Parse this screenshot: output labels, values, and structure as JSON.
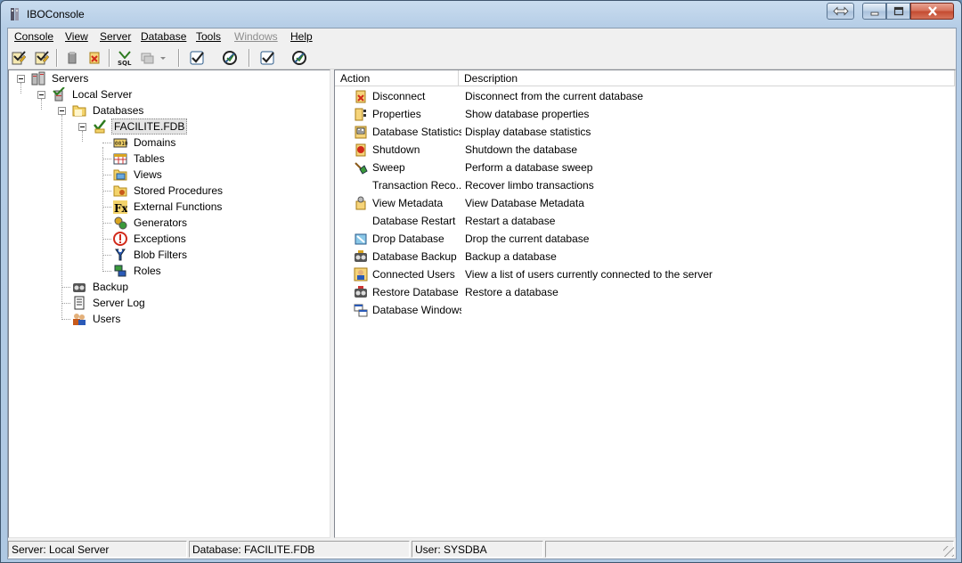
{
  "window": {
    "title": "IBOConsole"
  },
  "menu": [
    "Console",
    "View",
    "Server",
    "Database",
    "Tools",
    "Windows",
    "Help"
  ],
  "tree": {
    "servers": "Servers",
    "local_server": "Local Server",
    "databases": "Databases",
    "database": "FACILITE.FDB",
    "db_children": [
      "Domains",
      "Tables",
      "Views",
      "Stored Procedures",
      "External Functions",
      "Generators",
      "Exceptions",
      "Blob Filters",
      "Roles"
    ],
    "backup": "Backup",
    "server_log": "Server Log",
    "users": "Users"
  },
  "list": {
    "columns": [
      "Action",
      "Description"
    ],
    "rows": [
      {
        "action": "Disconnect",
        "description": "Disconnect from the current database",
        "icon": "disconnect-icon"
      },
      {
        "action": "Properties",
        "description": "Show database properties",
        "icon": "properties-icon"
      },
      {
        "action": "Database Statistics",
        "description": "Display database statistics",
        "icon": "statistics-icon"
      },
      {
        "action": "Shutdown",
        "description": "Shutdown the database",
        "icon": "shutdown-icon"
      },
      {
        "action": "Sweep",
        "description": "Perform a database sweep",
        "icon": "sweep-icon"
      },
      {
        "action": "Transaction Reco...",
        "description": "Recover limbo transactions",
        "icon": ""
      },
      {
        "action": "View Metadata",
        "description": "View Database Metadata",
        "icon": "metadata-icon"
      },
      {
        "action": "Database Restart",
        "description": "Restart a database",
        "icon": ""
      },
      {
        "action": "Drop Database",
        "description": "Drop the current database",
        "icon": "drop-icon"
      },
      {
        "action": "Database Backup",
        "description": "Backup a database",
        "icon": "backup-icon"
      },
      {
        "action": "Connected Users",
        "description": "View a list of users currently connected to the server",
        "icon": "users-icon"
      },
      {
        "action": "Restore Database",
        "description": "Restore a database",
        "icon": "restore-icon"
      },
      {
        "action": "Database Windows",
        "description": "",
        "icon": "windows-icon"
      }
    ]
  },
  "status": {
    "server": "Server: Local Server",
    "database": "Database: FACILITE.FDB",
    "user": "User: SYSDBA"
  },
  "colors": {
    "title_bar": "#b5cde6",
    "close_button": "#c44a2f",
    "selection": "#e5e5e5"
  }
}
